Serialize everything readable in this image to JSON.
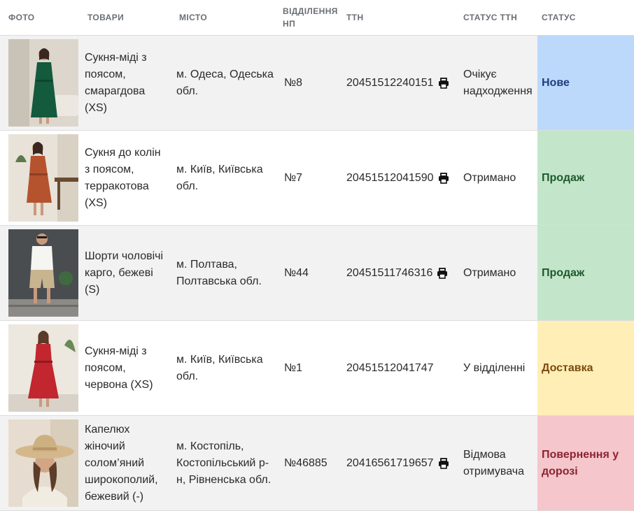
{
  "headers": {
    "photo": "ФОТО",
    "goods": "ТОВАРИ",
    "city": "МІСТО",
    "branch": "ВІДДІЛЕННЯ НП",
    "ttn": "ТТН",
    "ttn_status": "СТАТУС ТТН",
    "status": "СТАТУС"
  },
  "colors": {
    "new": "#bcd8fb",
    "sale": "#c3e6cb",
    "delivery": "#ffeeb5",
    "return": "#f5c6cb"
  },
  "rows": [
    {
      "product": "Сукня-міді з поясом, смарагдова (XS)",
      "city": "м. Одеса, Одеська обл.",
      "branch": "№8",
      "ttn": "20451512240151",
      "printable": true,
      "ttn_status": "Очікує надходження",
      "status": "Нове"
    },
    {
      "product": "Сукня до колін з поясом, терракотова (XS)",
      "city": "м. Київ, Київська обл.",
      "branch": "№7",
      "ttn": "20451512041590",
      "printable": true,
      "ttn_status": "Отримано",
      "status": "Продаж"
    },
    {
      "product": "Шорти чоловічі карго, бежеві (S)",
      "city": "м. Полтава, Полтавська обл.",
      "branch": "№44",
      "ttn": "20451511746316",
      "printable": true,
      "ttn_status": "Отримано",
      "status": "Продаж"
    },
    {
      "product": "Сукня-міді з поясом, червона (XS)",
      "city": "м. Київ, Київська обл.",
      "branch": "№1",
      "ttn": "20451512041747",
      "printable": false,
      "ttn_status": "У відділенні",
      "status": "Доставка"
    },
    {
      "product": "Капелюх жіночий солом’яний широкополий, бежевий (-)",
      "city": "м. Костопіль, Костопільський р-н, Рівненська обл.",
      "branch": "№46885",
      "ttn": "20416561719657",
      "printable": true,
      "ttn_status": "Відмова отримувача",
      "status": "Повернення у дорозі"
    }
  ]
}
